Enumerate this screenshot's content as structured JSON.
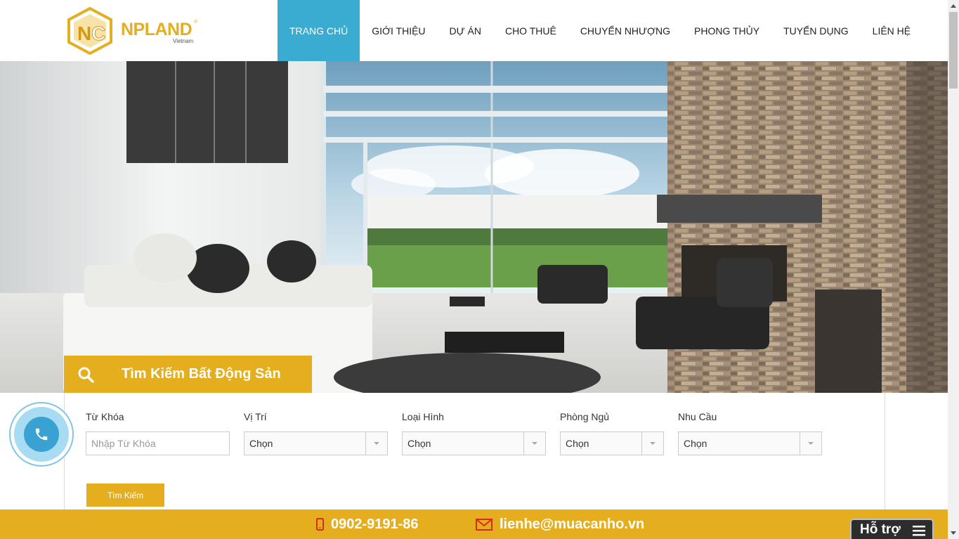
{
  "brand": {
    "name": "NPLAND",
    "sub": "Vietnam",
    "reg": "®"
  },
  "nav": [
    {
      "label": "TRANG CHỦ",
      "active": true
    },
    {
      "label": "GIỚI THIỆU",
      "active": false
    },
    {
      "label": "DỰ ÁN",
      "active": false
    },
    {
      "label": "CHO THUÊ",
      "active": false
    },
    {
      "label": "CHUYỂN NHƯỢNG",
      "active": false
    },
    {
      "label": "PHONG THỦY",
      "active": false
    },
    {
      "label": "TUYỂN DỤNG",
      "active": false
    },
    {
      "label": "LIÊN HỆ",
      "active": false
    }
  ],
  "search": {
    "title": "Tìm Kiếm Bất Động Sản",
    "keyword_label": "Từ Khóa",
    "keyword_placeholder": "Nhập Từ Khóa",
    "location_label": "Vị Trí",
    "location_value": "Chọn",
    "type_label": "Loại Hình",
    "type_value": "Chọn",
    "bedroom_label": "Phòng Ngủ",
    "bedroom_value": "Chọn",
    "need_label": "Nhu Cầu",
    "need_value": "Chọn",
    "button_label": "Tìm Kiếm"
  },
  "footer": {
    "phone": "0902-9191-86",
    "email": "lienhe@muacanho.vn",
    "support_label": "Hỗ trợ"
  },
  "colors": {
    "accent": "#e5ae1f",
    "nav_active": "#3aabd1",
    "phone_blue": "#3aa2d3"
  },
  "icons": [
    "search-icon",
    "phone-icon",
    "mobile-icon",
    "mail-icon",
    "menu-icon",
    "chevron-down-icon"
  ]
}
